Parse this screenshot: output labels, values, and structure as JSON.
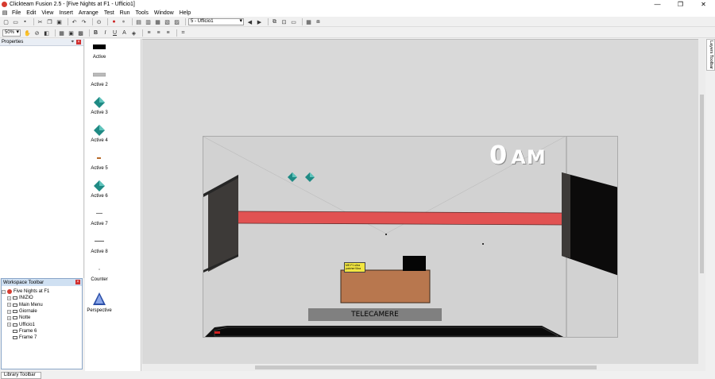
{
  "window": {
    "title": "Clickteam Fusion 2.5 - [Five Nights at F1 - Ufficio1]",
    "controls": [
      "—",
      "❐",
      "✕"
    ]
  },
  "menu": [
    "File",
    "Edit",
    "View",
    "Insert",
    "Arrange",
    "Test",
    "Run",
    "Tools",
    "Window",
    "Help"
  ],
  "toolbar": {
    "frame_selector": "5 - Ufficio1",
    "zoom": "50%",
    "bold": "B",
    "italic": "I",
    "underline": "U"
  },
  "properties_panel": {
    "title": "Properties"
  },
  "objects": [
    {
      "label": "Active"
    },
    {
      "label": "Active 2"
    },
    {
      "label": "Active 3"
    },
    {
      "label": "Active 4"
    },
    {
      "label": "Active 5"
    },
    {
      "label": "Active 6"
    },
    {
      "label": "Active 7"
    },
    {
      "label": "Active 8"
    },
    {
      "label": "Counter"
    },
    {
      "label": "Perspective"
    }
  ],
  "workspace": {
    "title": "Workspace Toolbar",
    "root": "Five Nights at F1",
    "frames": [
      "INIZIO",
      "Main Menu",
      "Giornale",
      "Notte",
      "Ufficio1",
      "Frame 6",
      "Frame 7"
    ]
  },
  "library_tab": "Library Toolbar",
  "layers_toolbar": "Layers Toolbar",
  "scene": {
    "clock_hour": "0",
    "clock_suffix": "AM",
    "camera_button": "TELECAMERE",
    "note_text": "ME:F1 ultra patcher!!Ara"
  },
  "colors": {
    "red_beam": "#e15252",
    "desk": "#b8774e",
    "door": "#3d3a38",
    "diamond": "#1f8a84"
  }
}
